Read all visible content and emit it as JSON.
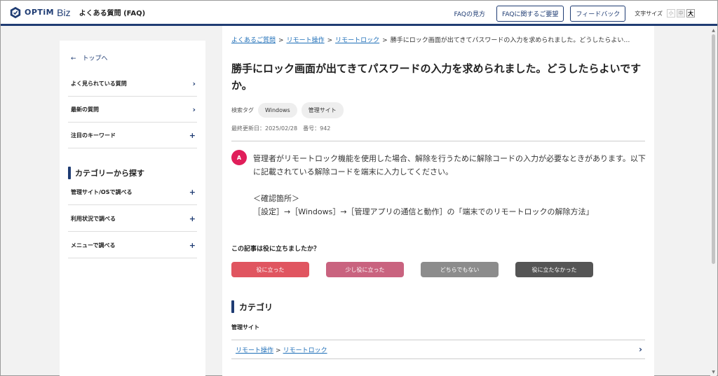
{
  "header": {
    "logo_text": "OPTiM",
    "logo_biz": "Biz",
    "site_title": "よくある質問 (FAQ)",
    "faq_guide": "FAQの見方",
    "request_button": "FAQに関するご要望",
    "feedback_button": "フィードバック",
    "font_size_label": "文字サイズ",
    "font_small": "小",
    "font_medium": "中",
    "font_large": "大"
  },
  "sidebar": {
    "back_link": "←　トップへ",
    "items": [
      {
        "label": "よく見られている質問",
        "icon": "›"
      },
      {
        "label": "最新の質問",
        "icon": "›"
      },
      {
        "label": "注目のキーワード",
        "icon": "+"
      }
    ],
    "category_heading": "カテゴリーから探す",
    "category_items": [
      {
        "label": "管理サイト/OSで調べる",
        "icon": "+"
      },
      {
        "label": "利用状況で調べる",
        "icon": "+"
      },
      {
        "label": "メニューで調べる",
        "icon": "+"
      }
    ]
  },
  "breadcrumb": {
    "items": [
      "よくあるご質問",
      "リモート操作",
      "リモートロック"
    ],
    "current": "勝手にロック画面が出てきてパスワードの入力を求められました。どうしたらよい…",
    "separator": ">"
  },
  "question": {
    "title": "勝手にロック画面が出てきてパスワードの入力を求められました。どうしたらよいですか。",
    "tags_label": "検索タグ",
    "tags": [
      "Windows",
      "管理サイト"
    ],
    "meta": "最終更新日：2025/02/28　番号：942"
  },
  "answer": {
    "badge": "A",
    "paragraph1": "管理者がリモートロック機能を使用した場合、解除を行うために解除コードの入力が必要なときがあります。以下に記載されている解除コードを端末に入力してください。",
    "paragraph2": "＜確認箇所＞",
    "paragraph3": "［設定］→［Windows］→［管理アプリの通信と動作］の「端末でのリモートロックの解除方法」"
  },
  "feedback": {
    "question": "この記事は役に立ちましたか？",
    "buttons": [
      {
        "label": "役に立った",
        "color": "#e05560"
      },
      {
        "label": "少し役に立った",
        "color": "#c9637f"
      },
      {
        "label": "どちらでもない",
        "color": "#8c8c8c"
      },
      {
        "label": "役に立たなかった",
        "color": "#555555"
      }
    ]
  },
  "category": {
    "heading": "カテゴリ",
    "subheading": "管理サイト",
    "path": [
      "リモート操作",
      "リモートロック"
    ],
    "separator": ">",
    "chevron": "›"
  },
  "colors": {
    "brand": "#1f3c73",
    "link": "#1f6fb8",
    "answer_badge": "#e01e5a"
  }
}
